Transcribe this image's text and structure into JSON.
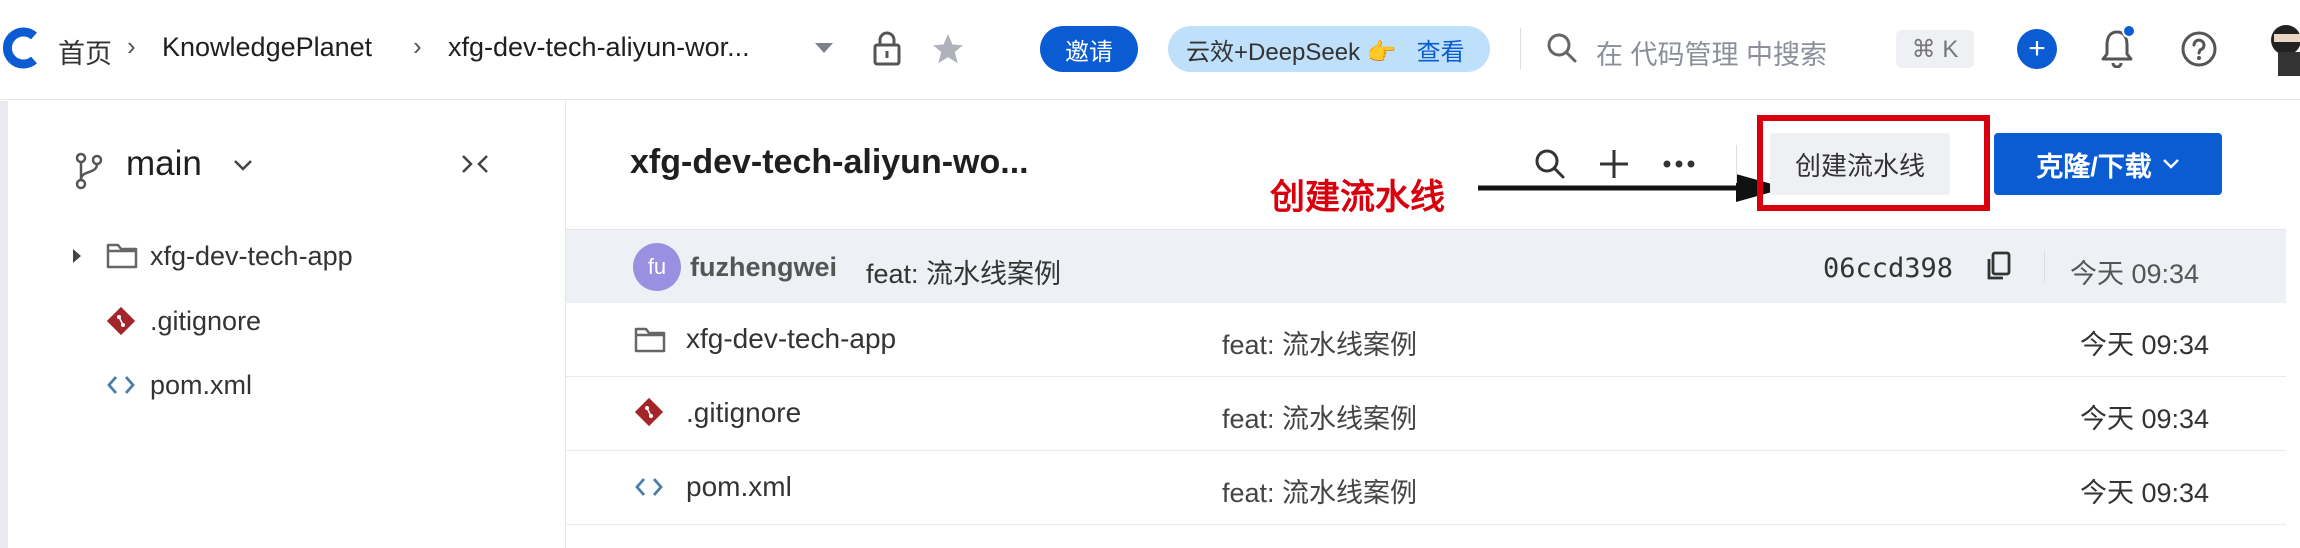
{
  "header": {
    "breadcrumbs": [
      "首页",
      "KnowledgePlanet",
      "xfg-dev-tech-aliyun-wor..."
    ],
    "invite_label": "邀请",
    "deepseek_label": "云效+DeepSeek 👉",
    "deepseek_view": "查看",
    "search_placeholder": "在 代码管理 中搜索",
    "shortcut": "⌘ K"
  },
  "sidebar": {
    "branch": "main",
    "items": [
      {
        "label": "xfg-dev-tech-app",
        "type": "folder"
      },
      {
        "label": ".gitignore",
        "type": "git"
      },
      {
        "label": "pom.xml",
        "type": "code"
      }
    ]
  },
  "main": {
    "repo_title": "xfg-dev-tech-aliyun-wo...",
    "create_pipeline_label": "创建流水线",
    "clone_label": "克隆/下载",
    "annotation_text": "创建流水线",
    "latest_commit": {
      "avatar_initials": "fu",
      "author": "fuzhengwei",
      "message": "feat: 流水线案例",
      "sha": "06ccd398",
      "time": "今天 09:34"
    },
    "files": [
      {
        "name": "xfg-dev-tech-app",
        "type": "folder",
        "message": "feat: 流水线案例",
        "time": "今天 09:34"
      },
      {
        "name": ".gitignore",
        "type": "git",
        "message": "feat: 流水线案例",
        "time": "今天 09:34"
      },
      {
        "name": "pom.xml",
        "type": "code",
        "message": "feat: 流水线案例",
        "time": "今天 09:34"
      }
    ]
  },
  "colors": {
    "accent": "#0b5bd3",
    "annotation": "#d8000c"
  }
}
